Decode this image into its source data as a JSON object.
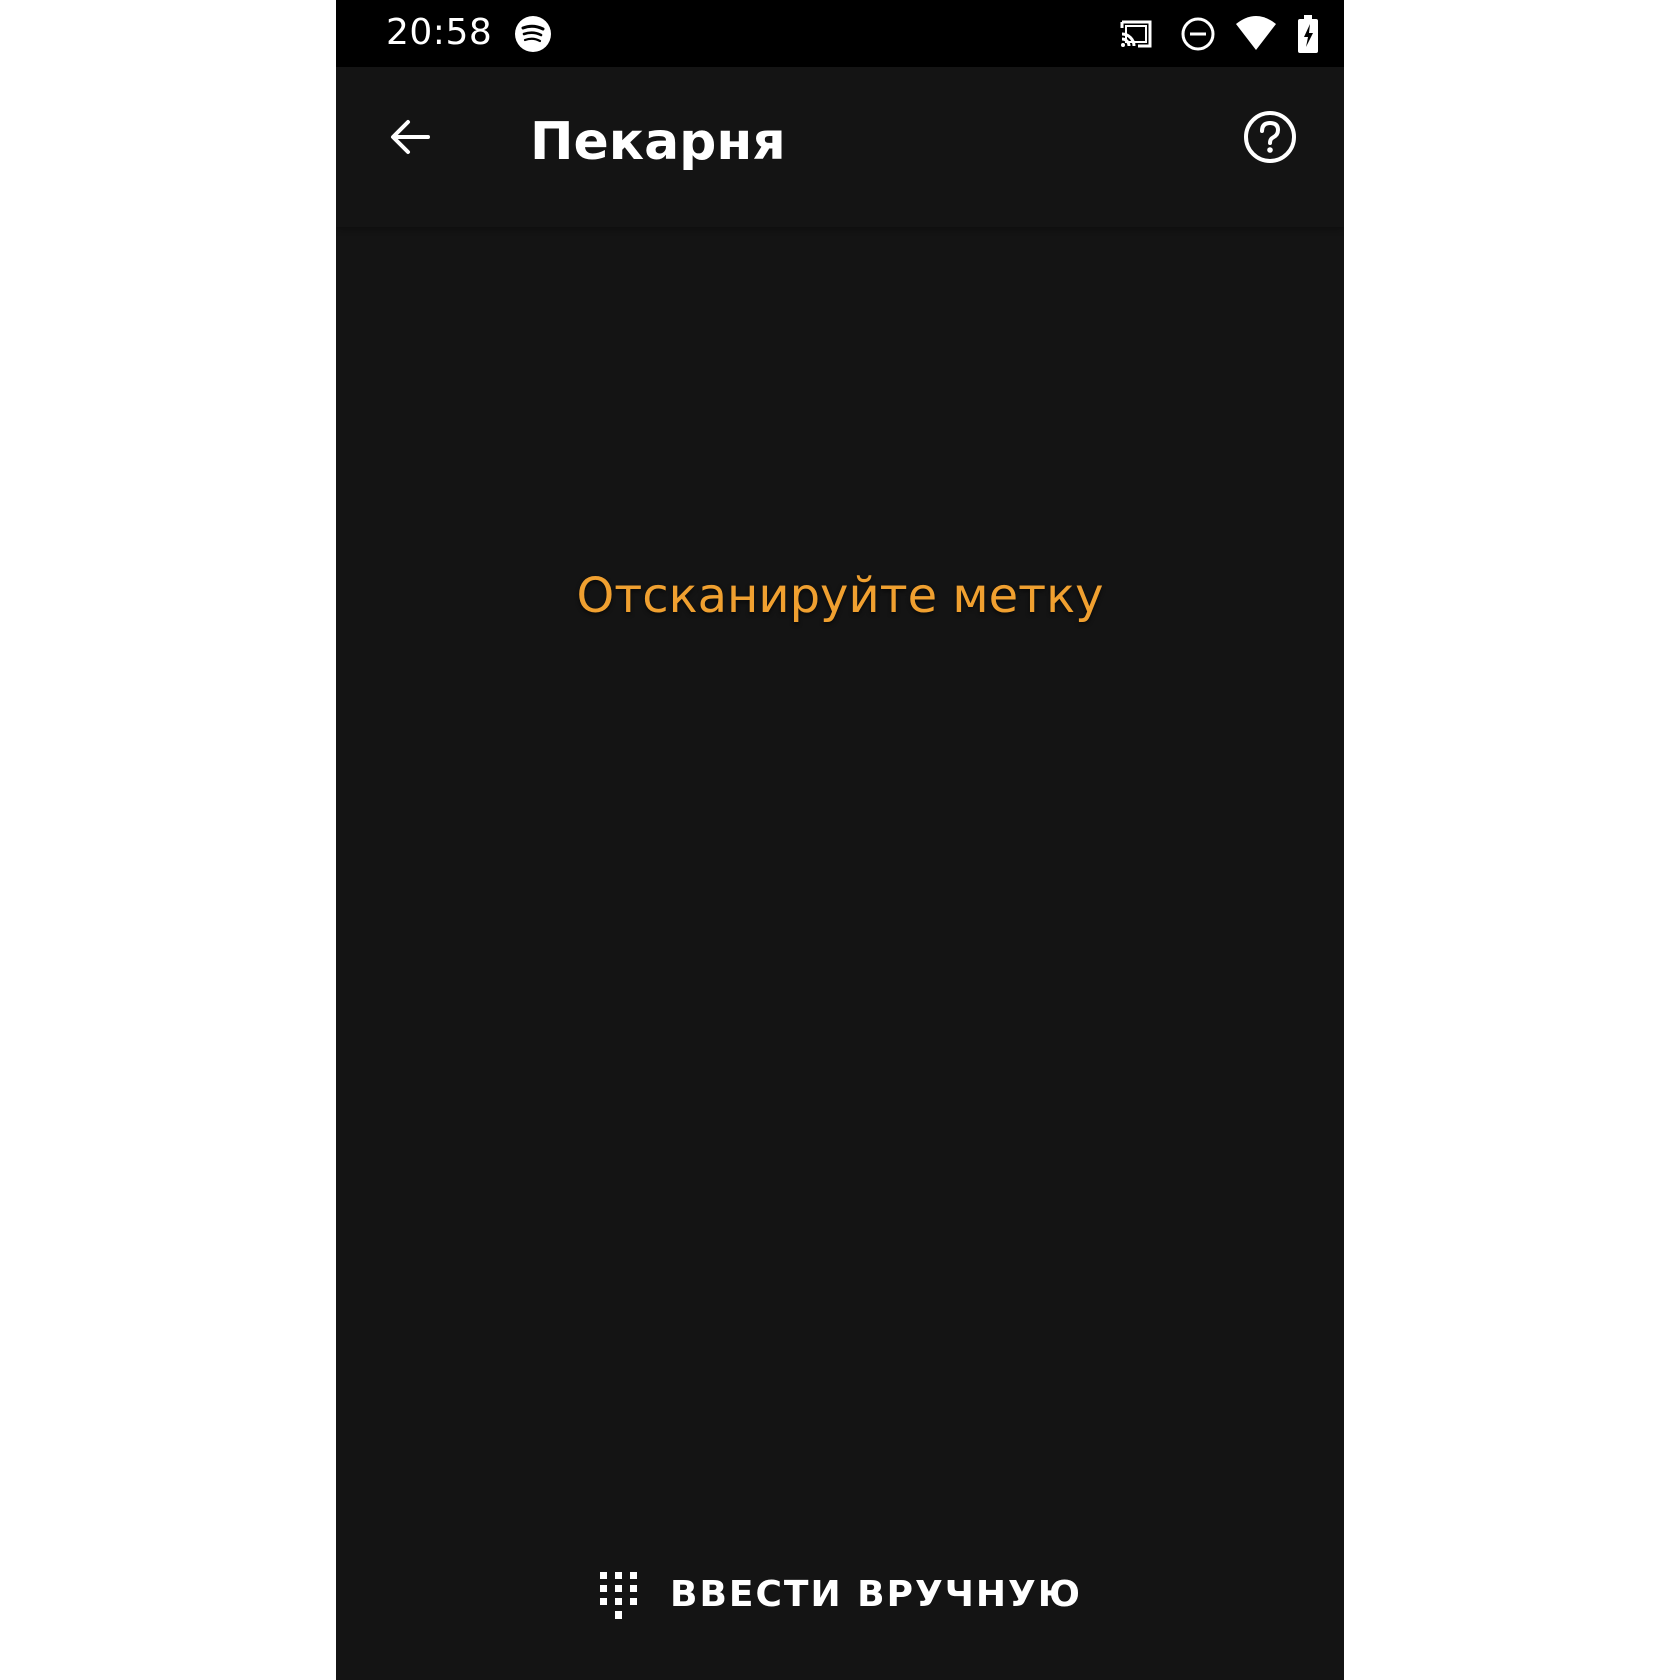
{
  "status_bar": {
    "time": "20:58",
    "icons": [
      "spotify-icon",
      "cast-icon",
      "do-not-disturb-icon",
      "wifi-icon",
      "battery-charging-icon"
    ]
  },
  "app_bar": {
    "title": "Пекарня",
    "back_icon": "arrow-left-icon",
    "help_icon": "help-circle-icon"
  },
  "main": {
    "prompt": "Отсканируйте метку"
  },
  "footer": {
    "manual_entry_label": "ВВЕСТИ ВРУЧНУЮ",
    "manual_entry_icon": "dialpad-icon"
  },
  "colors": {
    "background": "#141414",
    "status_bar": "#000000",
    "accent": "#f0a030",
    "text": "#ffffff"
  }
}
